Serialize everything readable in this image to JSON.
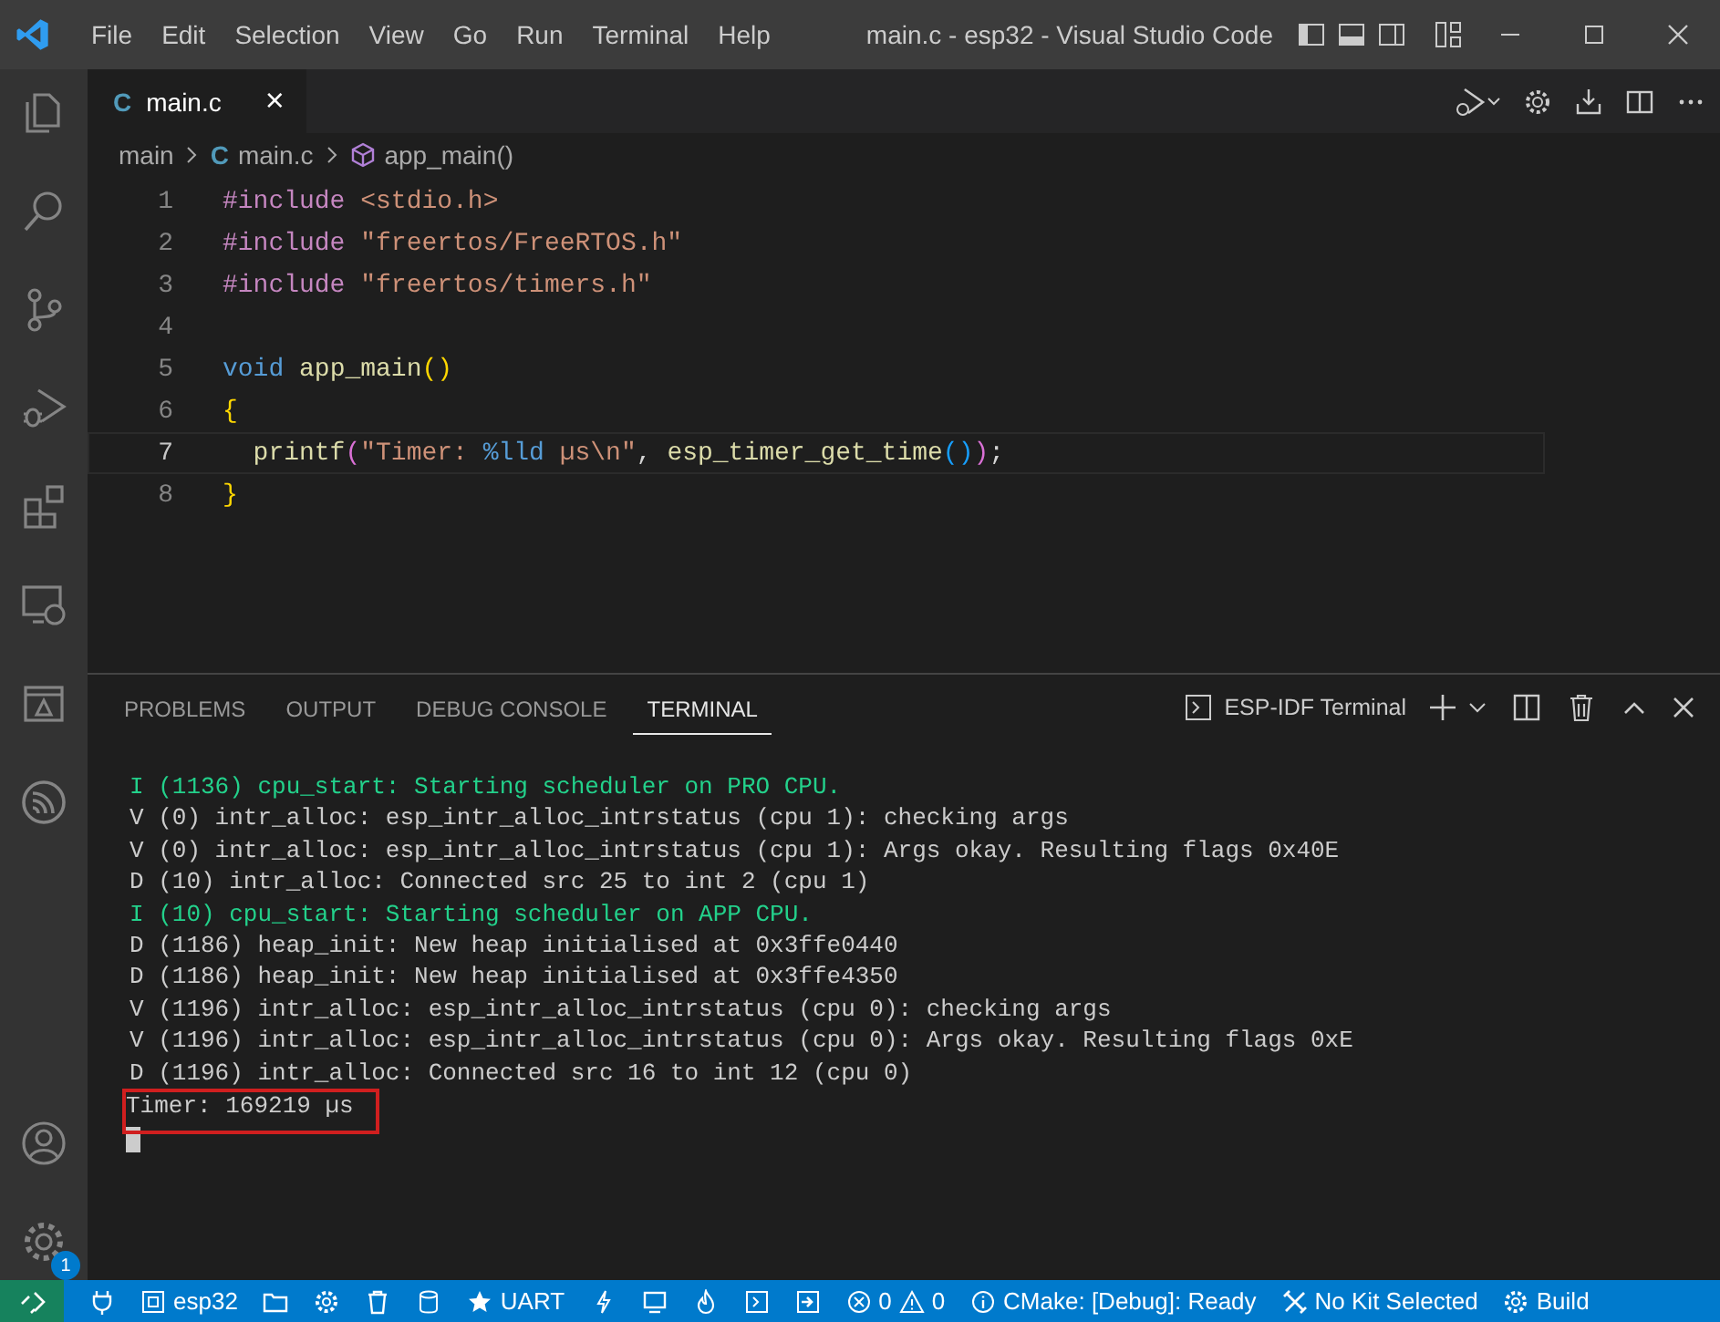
{
  "window": {
    "title": "main.c - esp32 - Visual Studio Code"
  },
  "menu": [
    "File",
    "Edit",
    "Selection",
    "View",
    "Go",
    "Run",
    "Terminal",
    "Help"
  ],
  "activity_bar": {
    "settings_badge": "1"
  },
  "tabs": [
    {
      "icon_letter": "C",
      "label": "main.c",
      "selected": true,
      "close": "×"
    }
  ],
  "breadcrumb": {
    "folder": "main",
    "file_letter": "C",
    "file": "main.c",
    "symbol": "app_main()"
  },
  "code_lines": [
    {
      "number": "1",
      "current": false,
      "tokens": [
        {
          "text": "#include ",
          "kind": "directive"
        },
        {
          "text": "<stdio.h>",
          "kind": "string"
        }
      ]
    },
    {
      "number": "2",
      "current": false,
      "tokens": [
        {
          "text": "#include ",
          "kind": "directive"
        },
        {
          "text": "\"freertos/FreeRTOS.h\"",
          "kind": "string"
        }
      ]
    },
    {
      "number": "3",
      "current": false,
      "tokens": [
        {
          "text": "#include ",
          "kind": "directive"
        },
        {
          "text": "\"freertos/timers.h\"",
          "kind": "string"
        }
      ]
    },
    {
      "number": "4",
      "current": false
    },
    {
      "number": "5",
      "current": false,
      "tokens": [
        {
          "text": "void ",
          "kind": "keyword"
        },
        {
          "text": "app_main",
          "kind": "function"
        },
        {
          "text": "()",
          "kind": "brace"
        }
      ]
    },
    {
      "number": "6",
      "current": false,
      "tokens": [
        {
          "text": "{",
          "kind": "brace"
        }
      ]
    },
    {
      "number": "7",
      "current": true,
      "tokens": [
        {
          "text": "  printf",
          "kind": "function"
        },
        {
          "text": "(",
          "kind": "paren"
        },
        {
          "text": "\"Timer: ",
          "kind": "string"
        },
        {
          "text": "%lld",
          "kind": "keyword"
        },
        {
          "text": " µs\\n\"",
          "kind": "string"
        },
        {
          "text": ", ",
          "kind": "plain"
        },
        {
          "text": "esp_timer_get_time",
          "kind": "function"
        },
        {
          "text": "()",
          "kind": "paren2"
        },
        {
          "text": ")",
          "kind": "paren"
        },
        {
          "text": ";",
          "kind": "plain"
        }
      ]
    },
    {
      "number": "8",
      "current": false,
      "tokens": [
        {
          "text": "}",
          "kind": "brace"
        }
      ]
    }
  ],
  "panel": {
    "tabs": [
      {
        "label": "PROBLEMS",
        "selected": false
      },
      {
        "label": "OUTPUT",
        "selected": false
      },
      {
        "label": "DEBUG CONSOLE",
        "selected": false
      },
      {
        "label": "TERMINAL",
        "selected": true
      }
    ],
    "terminal_name": "ESP-IDF Terminal"
  },
  "terminal_lines": [
    {
      "text": "I (1136) cpu_start: Starting scheduler on PRO CPU.",
      "kind": "info",
      "highlighted": false
    },
    {
      "text": "V (0) intr_alloc: esp_intr_alloc_intrstatus (cpu 1): checking args",
      "kind": "plain",
      "highlighted": false
    },
    {
      "text": "V (0) intr_alloc: esp_intr_alloc_intrstatus (cpu 1): Args okay. Resulting flags 0x40E",
      "kind": "plain",
      "highlighted": false
    },
    {
      "text": "D (10) intr_alloc: Connected src 25 to int 2 (cpu 1)",
      "kind": "plain",
      "highlighted": false
    },
    {
      "text": "I (10) cpu_start: Starting scheduler on APP CPU.",
      "kind": "info",
      "highlighted": false
    },
    {
      "text": "D (1186) heap_init: New heap initialised at 0x3ffe0440",
      "kind": "plain",
      "highlighted": false
    },
    {
      "text": "D (1186) heap_init: New heap initialised at 0x3ffe4350",
      "kind": "plain",
      "highlighted": false
    },
    {
      "text": "V (1196) intr_alloc: esp_intr_alloc_intrstatus (cpu 0): checking args",
      "kind": "plain",
      "highlighted": false
    },
    {
      "text": "V (1196) intr_alloc: esp_intr_alloc_intrstatus (cpu 0): Args okay. Resulting flags 0xE",
      "kind": "plain",
      "highlighted": false
    },
    {
      "text": "D (1196) intr_alloc: Connected src 16 to int 12 (cpu 0)",
      "kind": "plain",
      "highlighted": false
    },
    {
      "text": "Timer: 169219 µs",
      "kind": "plain",
      "highlighted": true
    }
  ],
  "status_bar": {
    "target": "esp32",
    "port": "UART",
    "errors": "0",
    "warnings": "0",
    "cmake": "CMake: [Debug]: Ready",
    "kit": "No Kit Selected",
    "build": "Build"
  }
}
